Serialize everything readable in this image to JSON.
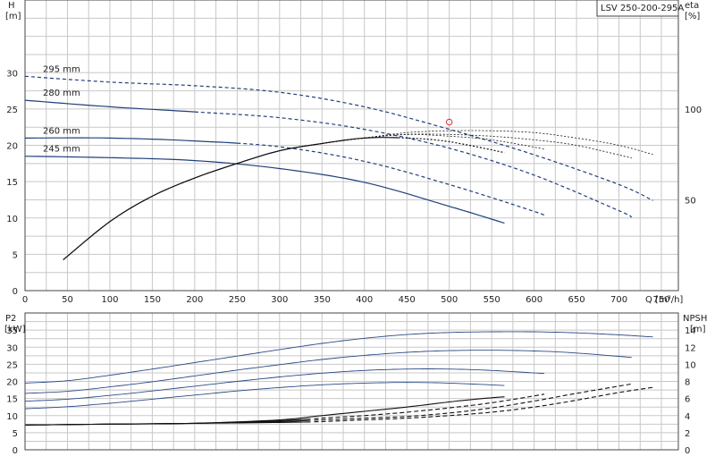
{
  "chart_data": [
    {
      "type": "line",
      "panel": "top",
      "title": "LSV 250-200-295A",
      "xlabel": "Q [m³/h]",
      "ylabel_left": {
        "symbol": "H",
        "unit": "[m]"
      },
      "ylabel_right": {
        "symbol": "eta",
        "unit": "[%]"
      },
      "xlim": [
        0,
        770
      ],
      "ylim": [
        0,
        40
      ],
      "y2lim": [
        0,
        160
      ],
      "grid": true,
      "x_ticks": [
        0,
        50,
        100,
        150,
        200,
        250,
        300,
        350,
        400,
        450,
        500,
        550,
        600,
        650,
        700,
        750
      ],
      "y_ticks": [
        0,
        5,
        10,
        15,
        20,
        25,
        30
      ],
      "y2_ticks": [
        50,
        100
      ],
      "colors": {
        "curve": "#1f3f7a",
        "eta": "#111111",
        "grid": "#c8c8c8",
        "marker": "#e03030"
      },
      "series": [
        {
          "name": "295 mm",
          "axis": "left",
          "solid_until": 0,
          "x": [
            0,
            100,
            200,
            300,
            400,
            500,
            600,
            700,
            740
          ],
          "y": [
            29.5,
            28.7,
            28.2,
            27.3,
            25.3,
            22.2,
            18.7,
            14.6,
            12.4
          ]
        },
        {
          "name": "280 mm",
          "axis": "left",
          "solid_until": 200,
          "x": [
            0,
            100,
            200,
            300,
            400,
            500,
            600,
            700,
            715
          ],
          "y": [
            26.2,
            25.3,
            24.6,
            23.8,
            22.2,
            19.6,
            15.9,
            11.0,
            10.1
          ]
        },
        {
          "name": "260 mm",
          "axis": "left",
          "solid_until": 250,
          "x": [
            0,
            100,
            200,
            300,
            400,
            500,
            600,
            612
          ],
          "y": [
            21.0,
            21.0,
            20.6,
            19.8,
            17.8,
            14.6,
            10.9,
            10.3
          ]
        },
        {
          "name": "245 mm",
          "axis": "left",
          "solid_until": 565,
          "x": [
            0,
            100,
            200,
            300,
            400,
            500,
            565
          ],
          "y": [
            18.5,
            18.3,
            17.9,
            16.8,
            14.9,
            11.6,
            9.3
          ]
        },
        {
          "axis": "right",
          "solid_until": 440,
          "x": [
            45,
            100,
            150,
            200,
            250,
            300,
            350,
            400,
            450,
            500,
            565
          ],
          "y": [
            17,
            38,
            52,
            62,
            70,
            77,
            81,
            84,
            84,
            82,
            76
          ]
        },
        {
          "axis": "right",
          "solid_until": 350,
          "x": [
            45,
            100,
            150,
            200,
            250,
            300,
            350,
            400,
            450,
            500,
            550,
            612
          ],
          "y": [
            17,
            38,
            52,
            62,
            70,
            77,
            81,
            84,
            86,
            85,
            83,
            78
          ]
        },
        {
          "axis": "right",
          "solid_until": 350,
          "x": [
            45,
            100,
            150,
            200,
            250,
            300,
            350,
            400,
            450,
            500,
            550,
            600,
            650,
            715
          ],
          "y": [
            17,
            38,
            52,
            62,
            70,
            77,
            81,
            84,
            86,
            86,
            85,
            83,
            80,
            73
          ]
        },
        {
          "axis": "right",
          "solid_until": 350,
          "x": [
            45,
            100,
            150,
            200,
            250,
            300,
            350,
            400,
            450,
            500,
            550,
            600,
            650,
            700,
            740
          ],
          "y": [
            17,
            38,
            52,
            62,
            70,
            77,
            81,
            84,
            87,
            88,
            88,
            87,
            84,
            80,
            75
          ]
        }
      ],
      "markers": [
        {
          "x": 500,
          "y": 23.2,
          "shape": "circle"
        }
      ]
    },
    {
      "type": "line",
      "panel": "bottom",
      "xlabel": "",
      "ylabel_left": {
        "symbol": "P2",
        "unit": "[kW]"
      },
      "ylabel_right": {
        "symbol": "NPSH",
        "unit": "[m]"
      },
      "xlim": [
        0,
        770
      ],
      "ylim": [
        0,
        40
      ],
      "y2lim": [
        0,
        16
      ],
      "grid": true,
      "y_ticks": [
        0,
        5,
        10,
        15,
        20,
        25,
        30,
        35
      ],
      "y2_ticks": [
        0,
        2,
        4,
        6,
        8,
        10,
        12,
        14
      ],
      "colors": {
        "p2": "#2a4a86",
        "npsh": "#111111"
      },
      "series": [
        {
          "kind": "P2",
          "axis": "left",
          "x": [
            0,
            50,
            100,
            150,
            200,
            250,
            300,
            350,
            400,
            450,
            500,
            550,
            600,
            650,
            700,
            740
          ],
          "y": [
            19.5,
            20.2,
            21.8,
            23.6,
            25.5,
            27.4,
            29.3,
            31.1,
            32.6,
            33.7,
            34.3,
            34.5,
            34.5,
            34.2,
            33.6,
            33.0
          ]
        },
        {
          "kind": "P2",
          "axis": "left",
          "x": [
            0,
            50,
            100,
            150,
            200,
            250,
            300,
            350,
            400,
            450,
            500,
            550,
            600,
            650,
            715
          ],
          "y": [
            16.5,
            17.1,
            18.4,
            19.9,
            21.6,
            23.3,
            24.9,
            26.4,
            27.6,
            28.5,
            29.0,
            29.1,
            28.9,
            28.3,
            27.0
          ]
        },
        {
          "kind": "P2",
          "axis": "left",
          "x": [
            0,
            50,
            100,
            150,
            200,
            250,
            300,
            350,
            400,
            450,
            500,
            550,
            612
          ],
          "y": [
            14.2,
            14.8,
            15.9,
            17.2,
            18.6,
            20.0,
            21.3,
            22.4,
            23.2,
            23.6,
            23.6,
            23.2,
            22.3
          ]
        },
        {
          "kind": "P2",
          "axis": "left",
          "x": [
            0,
            50,
            100,
            150,
            200,
            250,
            300,
            350,
            400,
            450,
            500,
            565
          ],
          "y": [
            12.0,
            12.6,
            13.6,
            14.8,
            16.0,
            17.2,
            18.2,
            19.0,
            19.5,
            19.7,
            19.5,
            18.8
          ]
        },
        {
          "kind": "NPSH",
          "axis": "right",
          "solid_until": 565,
          "x": [
            0,
            100,
            200,
            300,
            350,
            400,
            450,
            500,
            540,
            565
          ],
          "y": [
            2.9,
            3.0,
            3.1,
            3.5,
            4.0,
            4.5,
            5.0,
            5.6,
            6.0,
            6.2
          ]
        },
        {
          "kind": "NPSH",
          "axis": "right",
          "solid_until": 340,
          "x": [
            0,
            100,
            200,
            300,
            350,
            400,
            450,
            500,
            550,
            612
          ],
          "y": [
            2.9,
            3.0,
            3.1,
            3.4,
            3.7,
            4.0,
            4.4,
            4.9,
            5.5,
            6.5
          ]
        },
        {
          "kind": "NPSH",
          "axis": "right",
          "solid_until": 340,
          "x": [
            0,
            100,
            200,
            300,
            350,
            400,
            450,
            500,
            550,
            600,
            650,
            715
          ],
          "y": [
            2.9,
            3.0,
            3.1,
            3.3,
            3.5,
            3.7,
            3.9,
            4.3,
            4.9,
            5.7,
            6.6,
            7.7
          ]
        },
        {
          "kind": "NPSH",
          "axis": "right",
          "solid_until": 340,
          "x": [
            0,
            100,
            200,
            300,
            350,
            400,
            450,
            500,
            550,
            600,
            650,
            700,
            740
          ],
          "y": [
            2.9,
            3.0,
            3.1,
            3.2,
            3.3,
            3.5,
            3.7,
            4.0,
            4.4,
            5.0,
            5.8,
            6.7,
            7.3
          ]
        }
      ]
    }
  ]
}
